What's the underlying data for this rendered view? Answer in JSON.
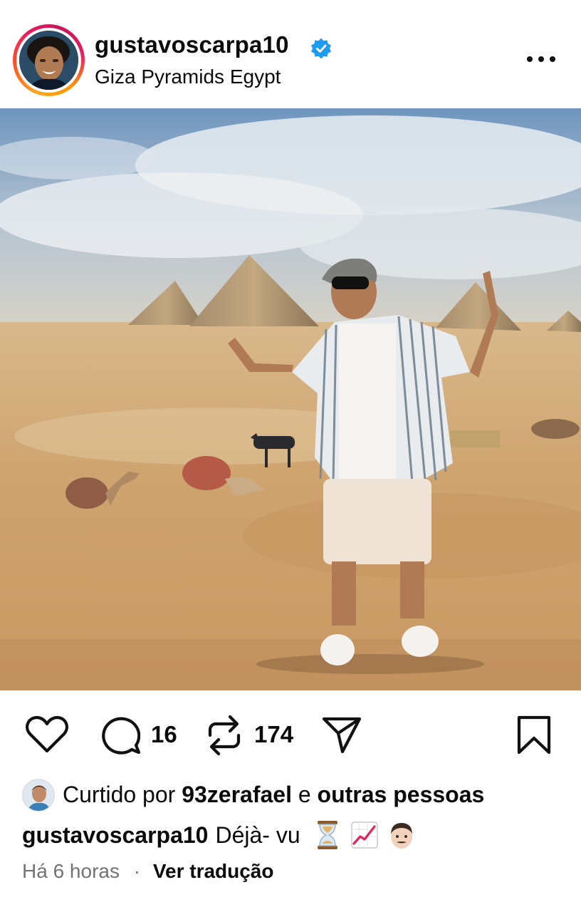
{
  "post": {
    "username": "gustavoscarpa10",
    "location": "Giza Pyramids Egypt",
    "verified_icon": "verified-badge-icon",
    "more_icon": "more-options-icon",
    "photo_subject": "pyramids-photo"
  },
  "actions": {
    "like_icon": "heart-icon",
    "comment_icon": "comment-icon",
    "comment_count": "16",
    "repost_icon": "repost-icon",
    "repost_count": "174",
    "share_icon": "send-icon",
    "save_icon": "bookmark-icon"
  },
  "likes": {
    "prefix": "Curtido por",
    "user": "93zerafael",
    "conj": "e",
    "others": "outras pessoas"
  },
  "caption": {
    "username": "gustavoscarpa10",
    "text": "Déjà- vu",
    "emojis": [
      "hourglass-emoji",
      "chart-increasing-emoji",
      "man-emoji"
    ]
  },
  "meta": {
    "time": "Há 6 horas",
    "separator": "·",
    "translate": "Ver tradução"
  },
  "colors": {
    "verified": "#1d9bf0",
    "text": "#0a0a0a",
    "muted": "#737373",
    "story_ring": [
      "#f9a825",
      "#e91e63"
    ]
  }
}
